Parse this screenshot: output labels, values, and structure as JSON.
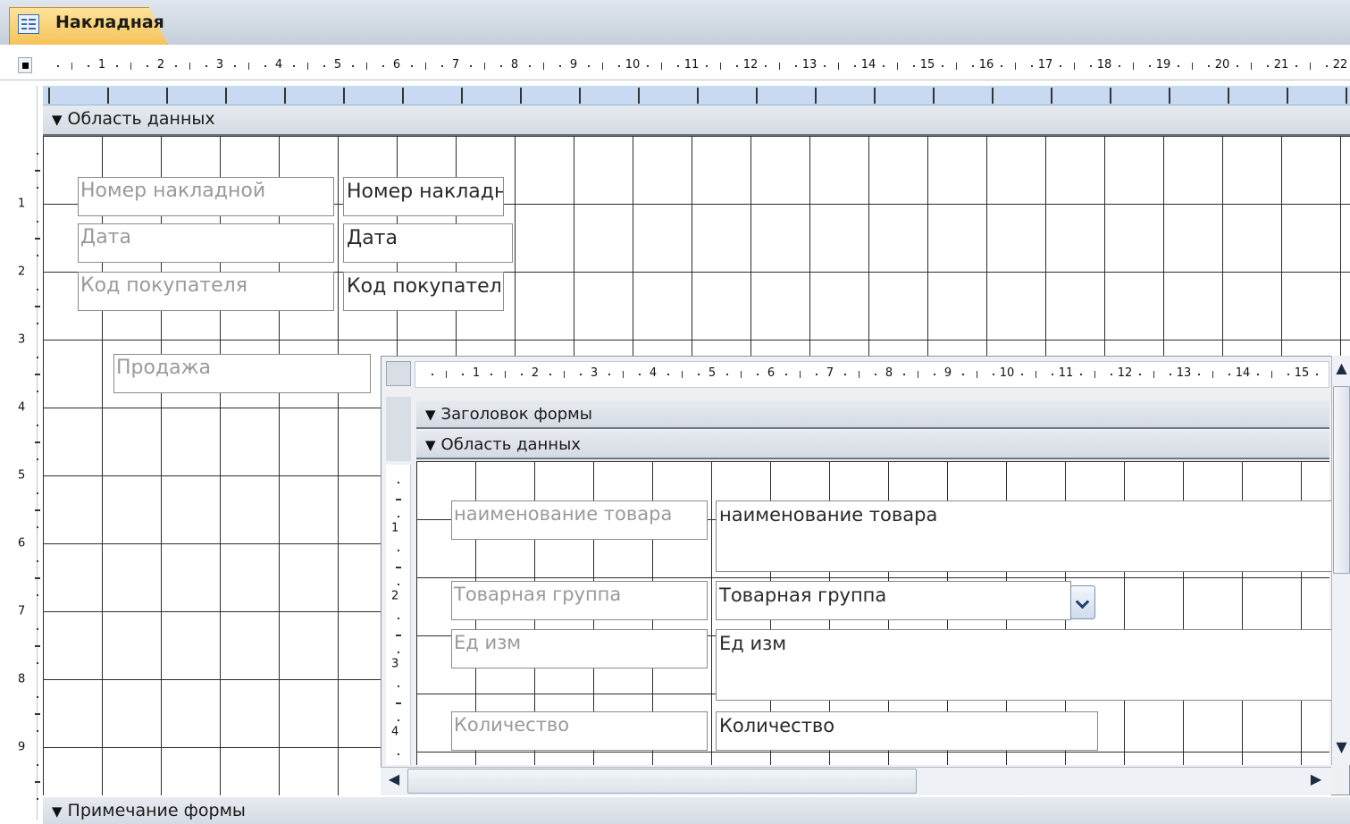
{
  "tab": {
    "title": "Накладная"
  },
  "outer_ruler": {
    "h_numbers": [
      "1",
      "2",
      "3",
      "4",
      "5",
      "6",
      "7",
      "8",
      "9",
      "10",
      "11",
      "12",
      "13",
      "14",
      "15",
      "16",
      "17",
      "18",
      "19",
      "20",
      "21",
      "22"
    ],
    "v_numbers": [
      "1",
      "2",
      "3",
      "4",
      "5",
      "6",
      "7",
      "8",
      "9"
    ]
  },
  "sections": {
    "detail": "Область данных",
    "footer": "Примечание формы"
  },
  "main_controls": {
    "number": {
      "label": "Номер накладной",
      "value": "Номер накладн"
    },
    "date": {
      "label": "Дата",
      "value": "Дата"
    },
    "customer": {
      "label": "Код покупателя",
      "value": "Код покупателя"
    },
    "sale_label": "Продажа"
  },
  "subform": {
    "ruler_numbers": [
      "1",
      "2",
      "3",
      "4",
      "5",
      "6",
      "7",
      "8",
      "9",
      "10",
      "11",
      "12",
      "13",
      "14",
      "15"
    ],
    "v_numbers": [
      "1",
      "2",
      "3",
      "4"
    ],
    "header_section": "Заголовок формы",
    "detail_section": "Область данных",
    "controls": {
      "product_name": {
        "label": "наименование товара",
        "value": "наименование товара"
      },
      "group": {
        "label": "Товарная группа",
        "value": "Товарная группа"
      },
      "unit": {
        "label": "Ед изм",
        "value": "Ед изм"
      },
      "quantity": {
        "label": "Количество",
        "value": "Количество"
      }
    }
  },
  "icons": {
    "tab": "form-icon",
    "section_toggle": "section-arrow-icon",
    "combo": "chevron-down-icon",
    "scroll_up": "arrow-up-icon",
    "scroll_down": "arrow-down-icon",
    "scroll_left": "arrow-left-icon",
    "scroll_right": "arrow-right-icon"
  }
}
